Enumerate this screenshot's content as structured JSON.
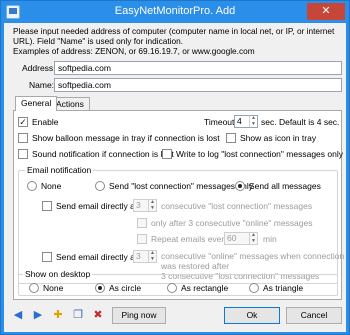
{
  "window": {
    "title": "EasyNetMonitorPro. Add",
    "close_glyph": "✕"
  },
  "intro": {
    "line1": "Please input needed address of computer (computer name in local net, or IP, or internet URL). Field \"Name\" is used only for indication.",
    "line2": "Examples of address:  ZENON, or  69.16.19.7, or www.google.com"
  },
  "address": {
    "label": "Address:",
    "value": "softpedia.com"
  },
  "name": {
    "label": "Name:",
    "value": "softpedia.com"
  },
  "tabs": {
    "general": "General",
    "actions": "Actions"
  },
  "general": {
    "enable": {
      "label": "Enable",
      "checked": true
    },
    "timeout": {
      "label": "Timeout:",
      "value": "4",
      "hint": "sec. Default is 4 sec."
    },
    "balloon": {
      "label": "Show balloon message in tray if connection is lost",
      "checked": false
    },
    "tray_icon": {
      "label": "Show as icon in tray",
      "checked": false
    },
    "sound": {
      "label": "Sound notification if connection is lost",
      "checked": false
    },
    "write_log": {
      "label": "Write to log \"lost connection\" messages only",
      "checked": false
    },
    "email_group": {
      "title": "Email notification",
      "options": [
        "None",
        "Send \"lost connection\" messages only",
        "Send all messages"
      ],
      "selected": "Send all messages"
    },
    "send_after": {
      "label": "Send email directly after",
      "value": "3",
      "suffix": "consecutive \"lost connection\" messages"
    },
    "only_after": {
      "label": "only after 3 consecutive \"online\" messages"
    },
    "repeat": {
      "label": "Repeat emails every",
      "value": "60",
      "unit": "min"
    },
    "send_after2": {
      "label": "Send email directly after",
      "value": "3",
      "suffix_line1": "consecutive \"online\" messages when connection",
      "suffix_line2": "was restored after",
      "suffix_line3": "3 consecutive \"lost connection\" messages"
    },
    "desktop_group": {
      "title": "Show on desktop",
      "options": [
        "None",
        "As circle",
        "As rectangle",
        "As triangle"
      ],
      "selected": "As circle"
    }
  },
  "footer": {
    "ping": "Ping now",
    "ok": "Ok",
    "cancel": "Cancel"
  },
  "icons": {
    "prev": "◀",
    "next": "▶",
    "add": "✚",
    "copy": "❐",
    "delete": "✖"
  }
}
